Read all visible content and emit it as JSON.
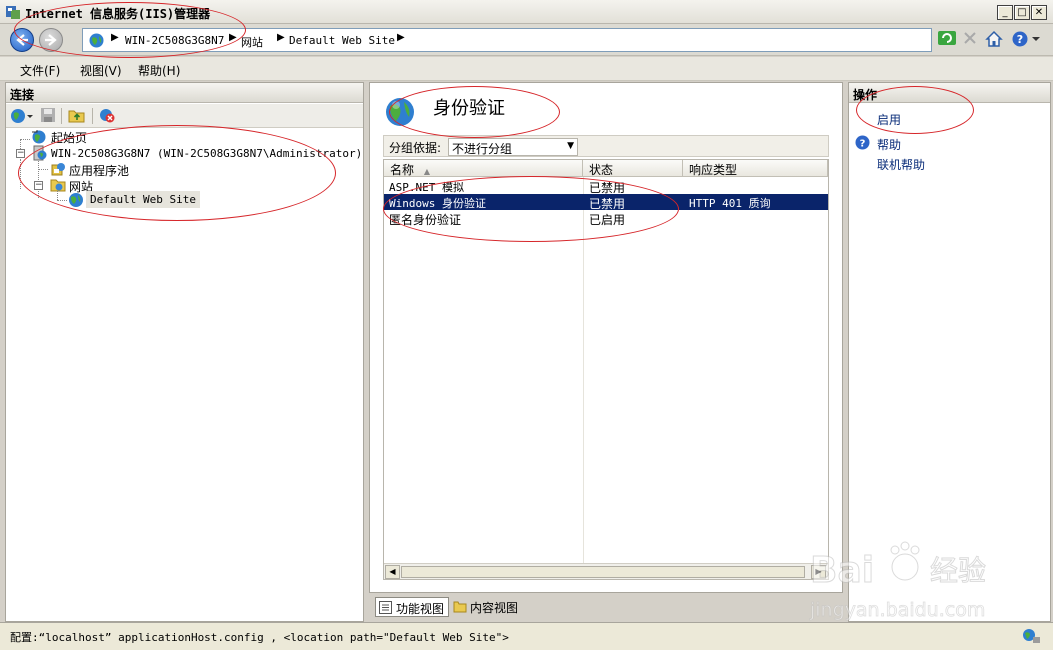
{
  "window": {
    "title": "Internet 信息服务(IIS)管理器"
  },
  "address": {
    "crumbs": [
      "WIN-2C508G3G8N7",
      "网站",
      "Default Web Site"
    ]
  },
  "menu": [
    "文件(F)",
    "视图(V)",
    "帮助(H)"
  ],
  "connections": {
    "header": "连接",
    "tree": {
      "start_page": "起始页",
      "server": "WIN-2C508G3G8N7 (WIN-2C508G3G8N7\\Administrator)",
      "app_pools": "应用程序池",
      "sites": "网站",
      "default_site": "Default Web Site"
    }
  },
  "feature": {
    "title": "身份验证",
    "group_label": "分组依据:",
    "group_value": "不进行分组",
    "columns": [
      "名称",
      "状态",
      "响应类型"
    ],
    "rows": [
      {
        "name": "ASP.NET 模拟",
        "status": "已禁用",
        "response": ""
      },
      {
        "name": "Windows 身份验证",
        "status": "已禁用",
        "response": "HTTP 401 质询"
      },
      {
        "name": "匿名身份验证",
        "status": "已启用",
        "response": ""
      }
    ],
    "selected_row": 1
  },
  "view_tabs": [
    "功能视图",
    "内容视图"
  ],
  "actions": {
    "header": "操作",
    "enable": "启用",
    "help": "帮助",
    "online_help": "联机帮助"
  },
  "status": {
    "text": "配置:“localhost” applicationHost.config , <location path=\"Default Web Site\">"
  },
  "watermark": {
    "brand": "Bai",
    "brand_cn": "经验",
    "url": "jingyan.baidu.com"
  },
  "colors": {
    "selection": "#0a246a",
    "annotation": "#d6262a",
    "link": "#0a2d7a"
  }
}
